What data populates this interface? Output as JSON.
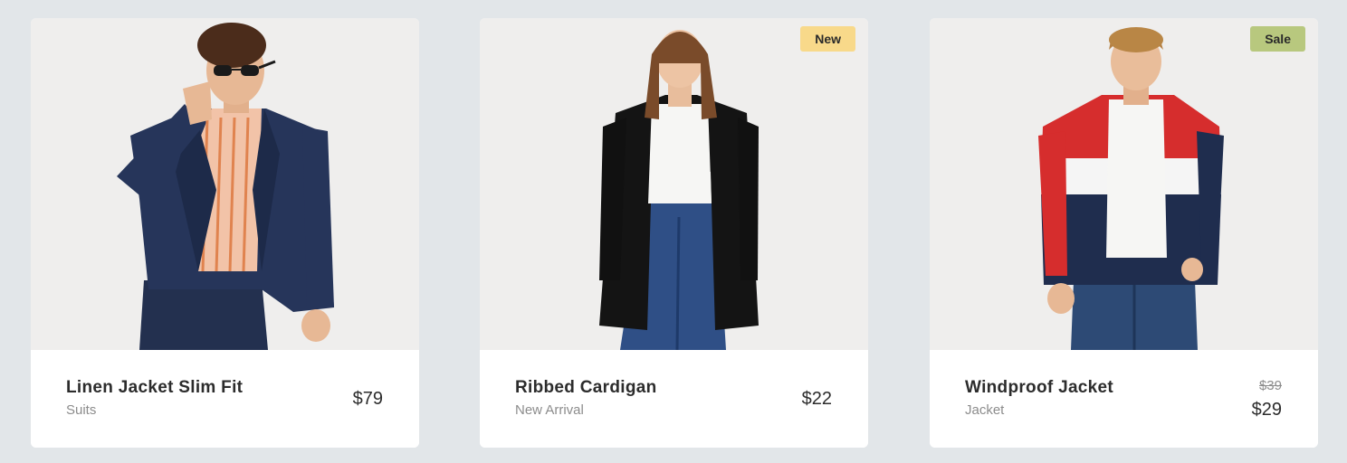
{
  "products": [
    {
      "name": "Linen Jacket Slim Fit",
      "category": "Suits",
      "price": "$79",
      "badge": null
    },
    {
      "name": "Ribbed Cardigan",
      "category": "New Arrival",
      "price": "$22",
      "badge": {
        "label": "New",
        "color": "#f8d98a"
      }
    },
    {
      "name": "Windproof Jacket",
      "category": "Jacket",
      "price": "$29",
      "old_price": "$39",
      "badge": {
        "label": "Sale",
        "color": "#b8c87e"
      }
    }
  ]
}
